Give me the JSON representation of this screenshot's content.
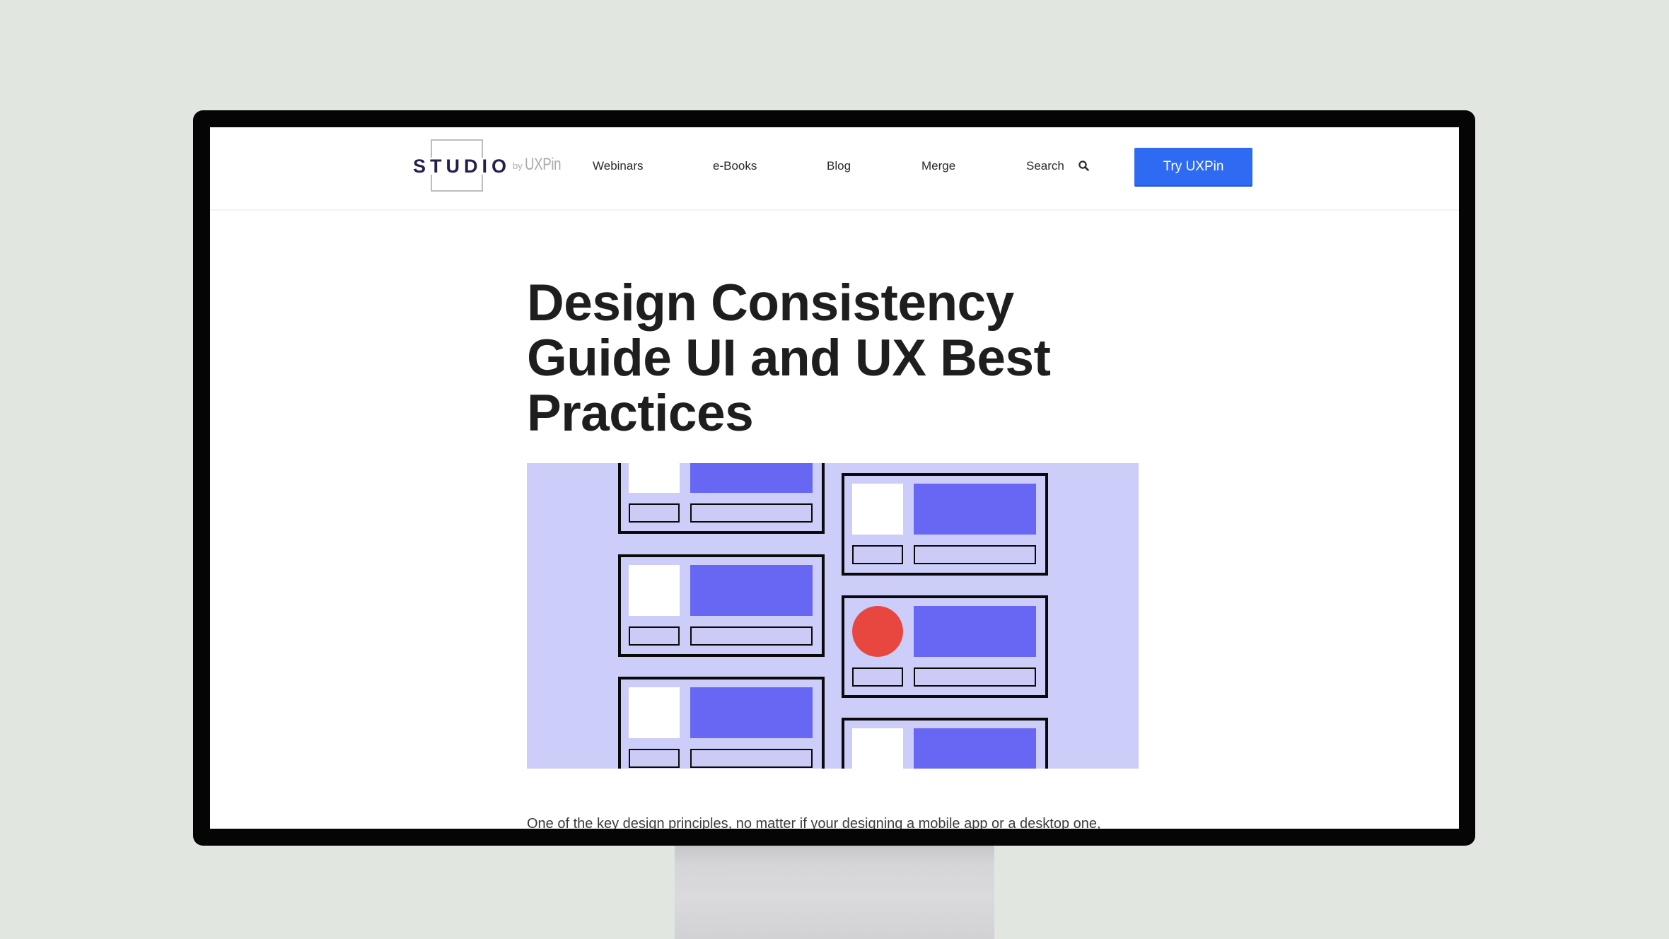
{
  "header": {
    "logo": {
      "studio": "STUDIO",
      "by": "by",
      "brand": "UXPin"
    },
    "nav": [
      {
        "label": "Webinars"
      },
      {
        "label": "e-Books"
      },
      {
        "label": "Blog"
      },
      {
        "label": "Merge"
      },
      {
        "label": "Search",
        "icon": "search-icon"
      }
    ],
    "cta_label": "Try UXPin",
    "cta_color": "#2F6BF2"
  },
  "article": {
    "title_lines": [
      "Design Consistency",
      "Guide UI and UX Best",
      "Practices"
    ],
    "hero": {
      "description": "Illustration of stacked UI cards in two columns",
      "colors": {
        "background": "#CDCDF9",
        "block": "#6767F4",
        "accent": "#E8473F",
        "thumb": "#FFFFFF"
      },
      "cards": [
        {
          "column": "left",
          "thumb": "square"
        },
        {
          "column": "left",
          "thumb": "square"
        },
        {
          "column": "left",
          "thumb": "square"
        },
        {
          "column": "right",
          "thumb": "square"
        },
        {
          "column": "right",
          "thumb": "circle"
        },
        {
          "column": "right",
          "thumb": "square"
        }
      ]
    },
    "intro": "One of the key design principles, no matter if your designing a mobile app or a desktop one,"
  }
}
